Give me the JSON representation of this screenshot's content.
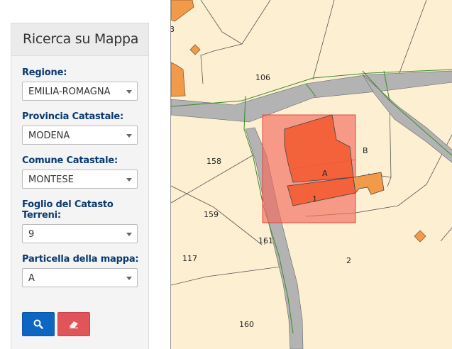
{
  "panel": {
    "title": "Ricerca su Mappa",
    "fields": [
      {
        "label": "Regione:",
        "value": "EMILIA-ROMAGNA"
      },
      {
        "label": "Provincia Catastale:",
        "value": "MODENA"
      },
      {
        "label": "Comune Catastale:",
        "value": "MONTESE"
      },
      {
        "label": "Foglio del Catasto Terreni:",
        "value": "9"
      },
      {
        "label": "Particella della mappa:",
        "value": "A"
      }
    ],
    "buttons": {
      "search_icon": "search-icon",
      "clear_icon": "eraser-icon"
    }
  },
  "map": {
    "labels": {
      "p3": "3",
      "p106": "106",
      "p158": "158",
      "p159": "159",
      "p161": "161",
      "p117": "117",
      "p2": "2",
      "p160": "160",
      "pA": "A",
      "pB": "B",
      "p1": "1"
    }
  },
  "colors": {
    "title_blue": "#0b3a70",
    "search_button": "#0d66c2",
    "clear_button": "#e0555a",
    "map_background": "#fdf0d2",
    "road": "#b3b3b3",
    "building": "#f29a4a",
    "selection": "#f26a5e"
  }
}
